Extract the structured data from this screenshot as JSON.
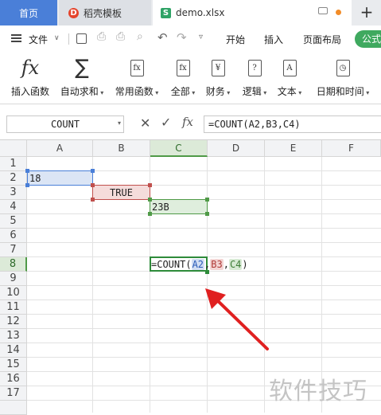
{
  "tabs": [
    {
      "label": "首页"
    },
    {
      "label": "稻壳模板"
    },
    {
      "label": "demo.xlsx"
    }
  ],
  "window_icons": {
    "new_tab": "+"
  },
  "menu": {
    "file": "文件",
    "items": [
      "开始",
      "插入",
      "页面布局",
      "公式"
    ]
  },
  "ribbon": {
    "items": [
      {
        "label": "插入函数",
        "icon": "fx-icon"
      },
      {
        "label": "自动求和",
        "icon": "sigma-icon"
      },
      {
        "label": "常用函数",
        "icon": "star-fx-icon"
      },
      {
        "label": "全部",
        "icon": "all-fx-icon"
      },
      {
        "label": "财务",
        "icon": "yen-icon"
      },
      {
        "label": "逻辑",
        "icon": "question-icon"
      },
      {
        "label": "文本",
        "icon": "text-icon"
      },
      {
        "label": "日期和时间",
        "icon": "clock-icon"
      }
    ]
  },
  "formula_bar": {
    "name_box": "COUNT",
    "formula": "=COUNT(A2,B3,C4)"
  },
  "columns": [
    "A",
    "B",
    "C",
    "D",
    "E",
    "F"
  ],
  "rows": [
    "1",
    "2",
    "3",
    "4",
    "5",
    "6",
    "7",
    "8",
    "9",
    "10",
    "11",
    "12",
    "13",
    "14",
    "15",
    "16",
    "17"
  ],
  "cells": {
    "A2": "18",
    "B3": "TRUE",
    "C4": "23B",
    "C8": {
      "prefix": "=COUNT(",
      "ref1": "A2",
      "sep1": ",",
      "ref2": "B3",
      "sep2": ",",
      "ref3": "C4",
      "suffix": ")"
    }
  },
  "watermark": "软件技巧",
  "colors": {
    "ref_a2": "#4a7fd8",
    "ref_b3": "#c0504d",
    "ref_c4": "#4f9a47",
    "arrow": "#e02020",
    "accent": "#4a7fd8"
  }
}
